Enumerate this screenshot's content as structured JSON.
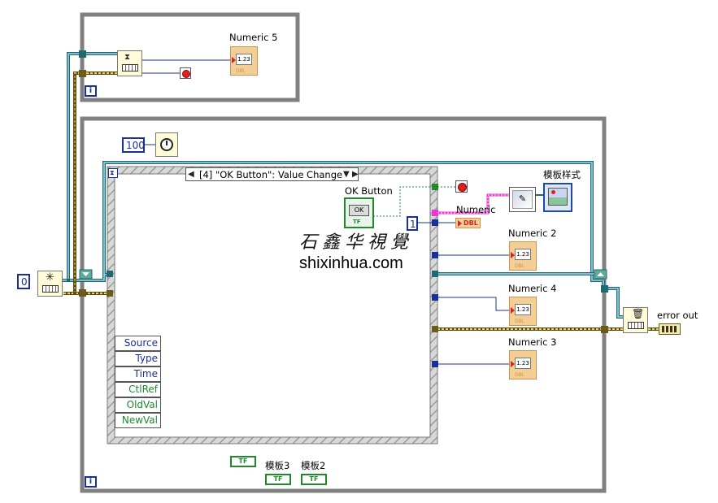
{
  "labels": {
    "numeric5": "Numeric 5",
    "ok_button": "OK Button",
    "numeric": "Numeric",
    "template_style": "模板样式",
    "numeric2": "Numeric 2",
    "numeric4": "Numeric 4",
    "numeric3": "Numeric 3",
    "error_out": "error out",
    "template3": "模板3",
    "template2": "模板2"
  },
  "constants": {
    "wait_ms": "100",
    "queue_init": "0",
    "one": "1"
  },
  "event_case": {
    "selector": "[4] \"OK Button\": Value Change"
  },
  "event_data_fields": [
    "Source",
    "Type",
    "Time",
    "CtlRef",
    "OldVal",
    "NewVal"
  ],
  "indicator_text": {
    "display": "1.23",
    "datatype": "DBL",
    "bool_type": "TF",
    "ok_face": "OK"
  },
  "watermark": {
    "chinese": "石鑫华視覺",
    "url": "shixinhua.com"
  },
  "iteration_label": "i",
  "colors": {
    "loop_border": "#808080",
    "numeric_wire": "#1a2f9a",
    "boolean_wire": "#1e8a2c",
    "error_wire": "#c8b432",
    "refnum_wire": "#1c6b74",
    "picture_wire": "#e43ad0",
    "stop_red": "#e21e1e",
    "indicator_fill": "#f3cf95"
  }
}
